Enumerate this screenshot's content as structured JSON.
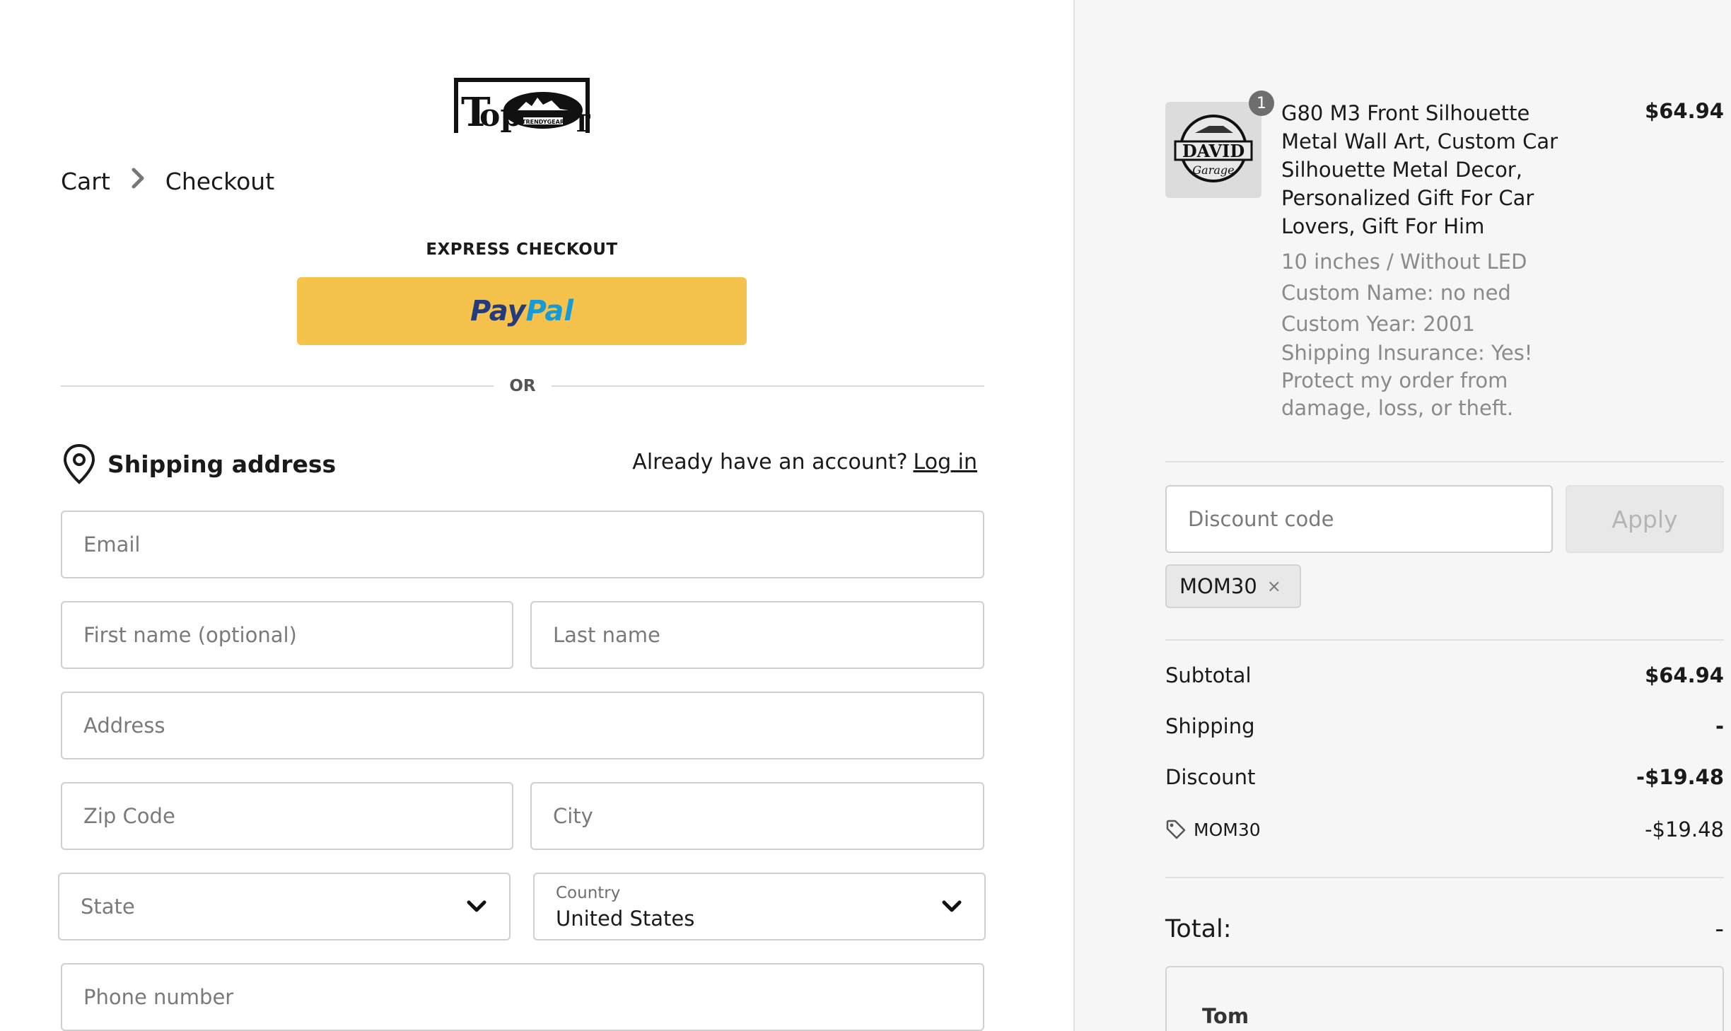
{
  "breadcrumb": {
    "cart": "Cart",
    "checkout": "Checkout"
  },
  "express": {
    "title": "EXPRESS CHECKOUT",
    "paypal_part1": "Pay",
    "paypal_part2": "Pal"
  },
  "or_label": "OR",
  "shipping": {
    "title": "Shipping address",
    "account_prompt": "Already have an account?",
    "login_label": "Log in"
  },
  "form": {
    "email_placeholder": "Email",
    "first_name_placeholder": "First name (optional)",
    "last_name_placeholder": "Last name",
    "address_placeholder": "Address",
    "zip_placeholder": "Zip Code",
    "city_placeholder": "City",
    "state_placeholder": "State",
    "country_label": "Country",
    "country_value": "United States",
    "phone_placeholder": "Phone number"
  },
  "order": {
    "quantity": "1",
    "product_name": "G80 M3 Front Silhouette Metal Wall Art, Custom Car Silhouette Metal Decor, Personalized Gift For Car Lovers, Gift For Him",
    "price": "$64.94",
    "variant": "10 inches / Without LED",
    "custom_name": "Custom Name: no ned",
    "custom_year": "Custom Year: 2001",
    "insurance": "Shipping Insurance: Yes! Protect my order from damage, loss, or theft."
  },
  "discount": {
    "placeholder": "Discount code",
    "apply_label": "Apply",
    "applied_code": "MOM30",
    "remove_glyph": "×"
  },
  "summary": {
    "subtotal_label": "Subtotal",
    "subtotal_value": "$64.94",
    "shipping_label": "Shipping",
    "shipping_value": "-",
    "discount_label": "Discount",
    "discount_value": "-$19.48",
    "promo_code": "MOM30",
    "promo_value": "-$19.48",
    "total_label": "Total:",
    "total_value": "-"
  },
  "payment": {
    "name": "Tom"
  },
  "colors": {
    "paypal_yellow": "#f5c24c",
    "paypal_dark_blue": "#253b80",
    "paypal_light_blue": "#179bd7",
    "sidebar_bg": "#f6f6f6"
  },
  "icons": [
    "store-logo",
    "chevron-right-icon",
    "location-pin-icon",
    "chevron-down-icon",
    "tag-icon",
    "close-icon"
  ]
}
